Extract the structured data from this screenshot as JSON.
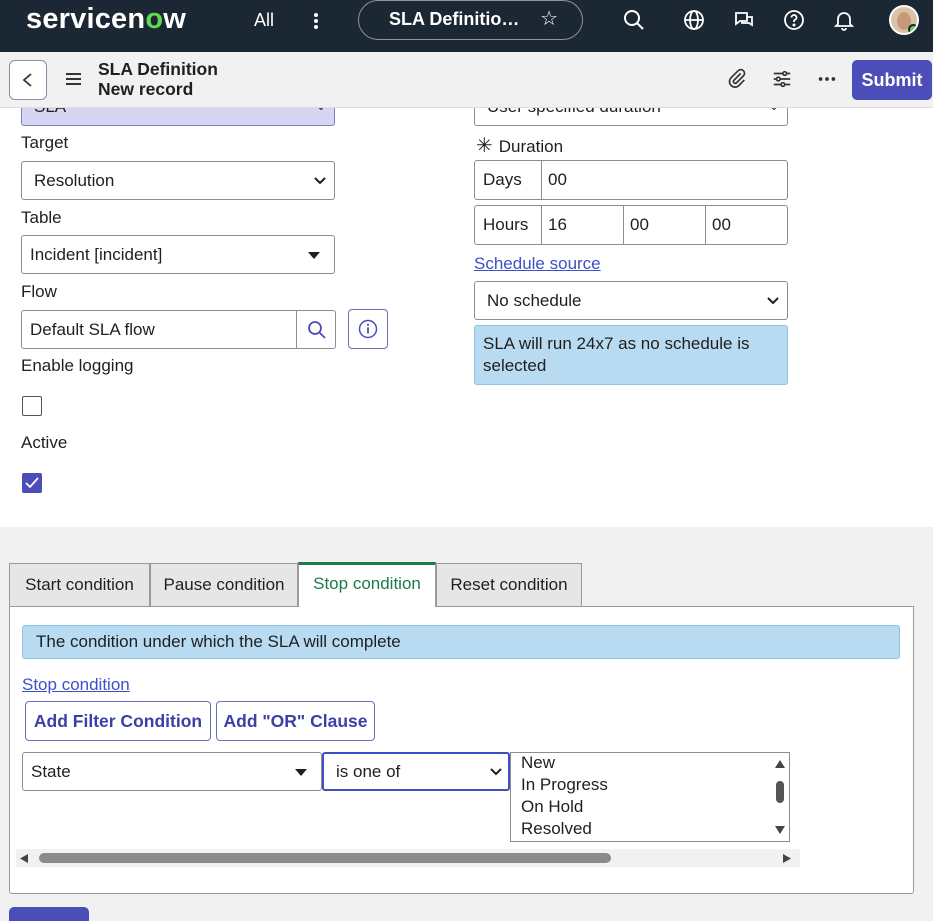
{
  "nav": {
    "brand_pre": "servicen",
    "brand_o": "o",
    "brand_post": "w",
    "all_label": "All",
    "pill_title": "SLA Definitio…",
    "icons": [
      "search-icon",
      "globe-icon",
      "chat-icon",
      "help-icon",
      "bell-icon"
    ]
  },
  "header": {
    "title": "SLA Definition",
    "subtitle": "New record",
    "submit_label": "Submit",
    "icons": [
      "back-icon",
      "menu-icon",
      "attachment-icon",
      "settings-sliders-icon",
      "more-icon"
    ]
  },
  "form": {
    "top_left_partial": "SLA",
    "top_right_partial": "User specified duration",
    "target_label": "Target",
    "target_value": "Resolution",
    "table_label": "Table",
    "table_value": "Incident [incident]",
    "flow_label": "Flow",
    "flow_value": "Default SLA flow",
    "enable_logging_label": "Enable logging",
    "enable_logging_checked": false,
    "active_label": "Active",
    "active_checked": true,
    "duration_label": "Duration",
    "days_label": "Days",
    "days_value": "00",
    "hours_label": "Hours",
    "hours_value": "16",
    "minutes_value": "00",
    "seconds_value": "00",
    "schedule_source_link": "Schedule source",
    "schedule_value": "No schedule",
    "schedule_info": "SLA will run 24x7 as no schedule is selected"
  },
  "conditions": {
    "tabs": [
      {
        "label": "Start condition",
        "active": false
      },
      {
        "label": "Pause condition",
        "active": false
      },
      {
        "label": "Stop condition",
        "active": true
      },
      {
        "label": "Reset condition",
        "active": false
      }
    ],
    "info": "The condition under which the SLA will complete",
    "link": "Stop condition",
    "add_filter_label": "Add Filter Condition",
    "add_or_label": "Add \"OR\" Clause",
    "field_value": "State",
    "operator_value": "is one of",
    "options": [
      "New",
      "In Progress",
      "On Hold",
      "Resolved"
    ]
  },
  "colors": {
    "nav_bg": "#1b2733",
    "accent": "#4b4eb8",
    "active_tab": "#1d7a4b",
    "info_bg": "#b8dbf1"
  }
}
